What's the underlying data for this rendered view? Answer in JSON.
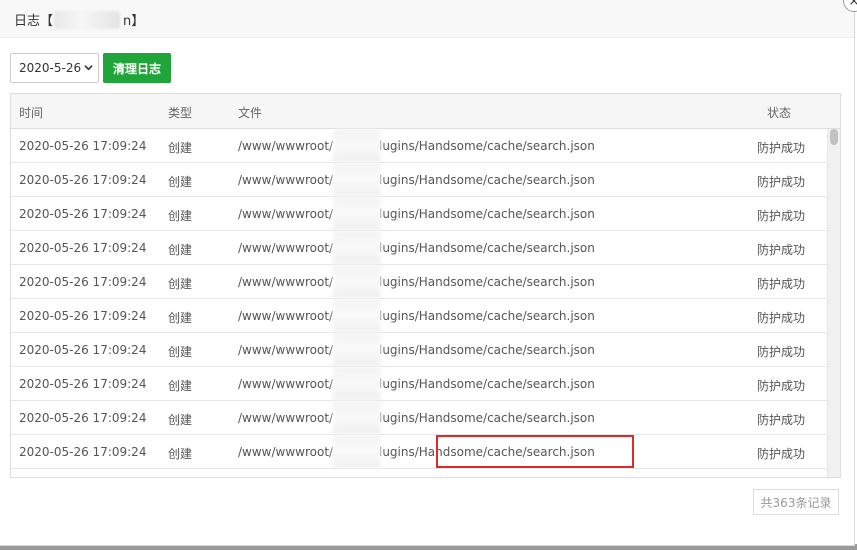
{
  "dialog": {
    "title_prefix": "日志【",
    "title_suffix": "n】",
    "close_glyph": "×"
  },
  "toolbar": {
    "date_value": "2020-5-26",
    "clear_label": "清理日志"
  },
  "table": {
    "headers": {
      "time": "时间",
      "type": "类型",
      "file": "文件",
      "state": "状态"
    },
    "rows": [
      {
        "time": "2020-05-26 17:09:24",
        "type": "创建",
        "file": "/www/wwwroot/          n/usr/plugins/Handsome/cache/search.json",
        "state": "防护成功"
      },
      {
        "time": "2020-05-26 17:09:24",
        "type": "创建",
        "file": "/www/wwwroot/          n/usr/plugins/Handsome/cache/search.json",
        "state": "防护成功"
      },
      {
        "time": "2020-05-26 17:09:24",
        "type": "创建",
        "file": "/www/wwwroot/          n/usr/plugins/Handsome/cache/search.json",
        "state": "防护成功"
      },
      {
        "time": "2020-05-26 17:09:24",
        "type": "创建",
        "file": "/www/wwwroot/          n/usr/plugins/Handsome/cache/search.json",
        "state": "防护成功"
      },
      {
        "time": "2020-05-26 17:09:24",
        "type": "创建",
        "file": "/www/wwwroot/          n/usr/plugins/Handsome/cache/search.json",
        "state": "防护成功"
      },
      {
        "time": "2020-05-26 17:09:24",
        "type": "创建",
        "file": "/www/wwwroot/          n/usr/plugins/Handsome/cache/search.json",
        "state": "防护成功"
      },
      {
        "time": "2020-05-26 17:09:24",
        "type": "创建",
        "file": "/www/wwwroot/          n/usr/plugins/Handsome/cache/search.json",
        "state": "防护成功"
      },
      {
        "time": "2020-05-26 17:09:24",
        "type": "创建",
        "file": "/www/wwwroot/          n/usr/plugins/Handsome/cache/search.json",
        "state": "防护成功"
      },
      {
        "time": "2020-05-26 17:09:24",
        "type": "创建",
        "file": "/www/wwwroot/          n/usr/plugins/Handsome/cache/search.json",
        "state": "防护成功"
      },
      {
        "time": "2020-05-26 17:09:24",
        "type": "创建",
        "file": "/www/wwwroot/          n/usr/plugins/Handsome/cache/search.json",
        "state": "防护成功"
      }
    ]
  },
  "pager": {
    "total_label": "共363条记录"
  },
  "colors": {
    "accent_green": "#20a53a",
    "highlight_red": "#e0292b"
  }
}
